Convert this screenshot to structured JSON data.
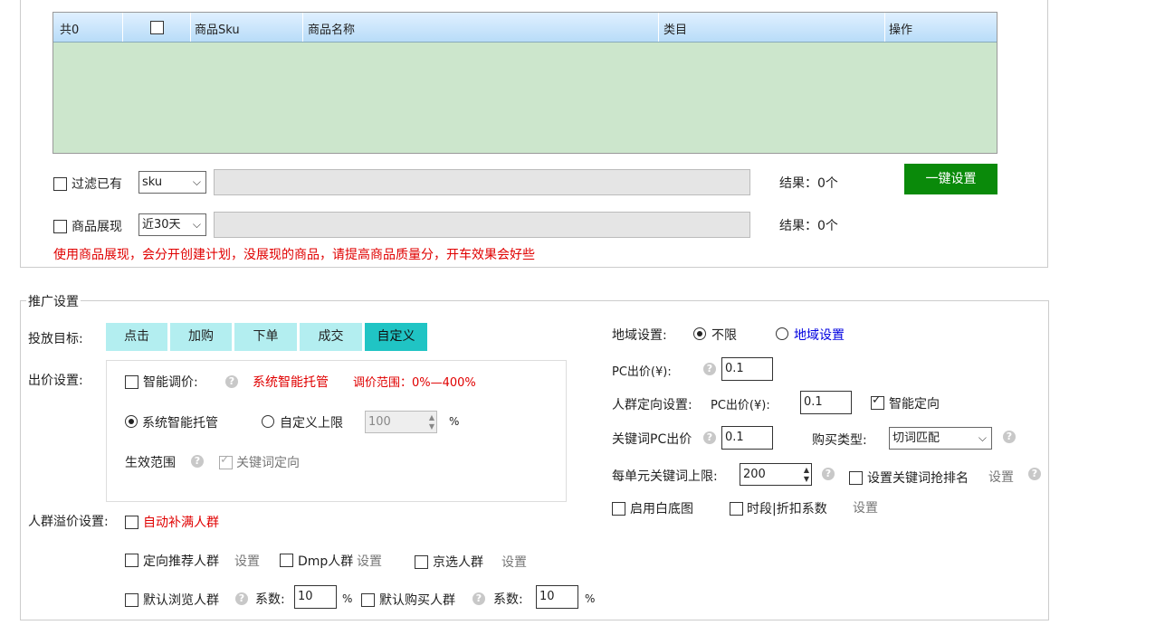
{
  "table": {
    "headers": [
      "共0",
      "",
      "商品Sku",
      "商品名称",
      "类目",
      "操作"
    ]
  },
  "filter_row1": {
    "label": "过滤已有",
    "select_value": "sku",
    "result": "结果：0个",
    "button": "一键设置"
  },
  "filter_row2": {
    "label": "商品展现",
    "select_value": "近30天",
    "result": "结果：0个"
  },
  "warning": "使用商品展现，会分开创建计划，没展现的商品，请提高商品质量分，开车效果会好些",
  "promo": {
    "legend": "推广设置",
    "target_label": "投放目标:",
    "targets": [
      "点击",
      "加购",
      "下单",
      "成交",
      "自定义"
    ],
    "bid_label": "出价设置:",
    "smart_adjust": "智能调价:",
    "sys_managed_red": "系统智能托管",
    "adjust_range": "调价范围：0%—400%",
    "radio_sys": "系统智能托管",
    "radio_custom": "自定义上限",
    "custom_value": "100",
    "percent": "%",
    "scope_label": "生效范围",
    "scope_keyword": "关键词定向",
    "crowd_label": "人群溢价设置:",
    "auto_fill": "自动补满人群",
    "recommend_crowd": "定向推荐人群",
    "set": "设置",
    "dmp_crowd": "Dmp人群",
    "jd_crowd": "京选人群",
    "browse_crowd": "默认浏览人群",
    "coef_label": "系数:",
    "browse_coef": "10",
    "buy_crowd": "默认购买人群",
    "buy_coef": "10"
  },
  "right": {
    "region_label": "地域设置:",
    "region_unlimited": "不限",
    "region_set": "地域设置",
    "pc_bid_label": "PC出价(¥):",
    "pc_bid": "0.1",
    "crowd_setting_label": "人群定向设置:",
    "crowd_pc_label": "PC出价(¥):",
    "crowd_pc_bid": "0.1",
    "smart_target": "智能定向",
    "kw_pc_label": "关键词PC出价",
    "kw_pc_bid": "0.1",
    "buy_type_label": "购买类型:",
    "buy_type_value": "切词匹配",
    "kw_limit_label": "每单元关键词上限:",
    "kw_limit_value": "200",
    "kw_rank": "设置关键词抢排名",
    "set": "设置",
    "white_bg": "启用白底图",
    "time_discount": "时段|折扣系数",
    "time_set": "设置"
  }
}
